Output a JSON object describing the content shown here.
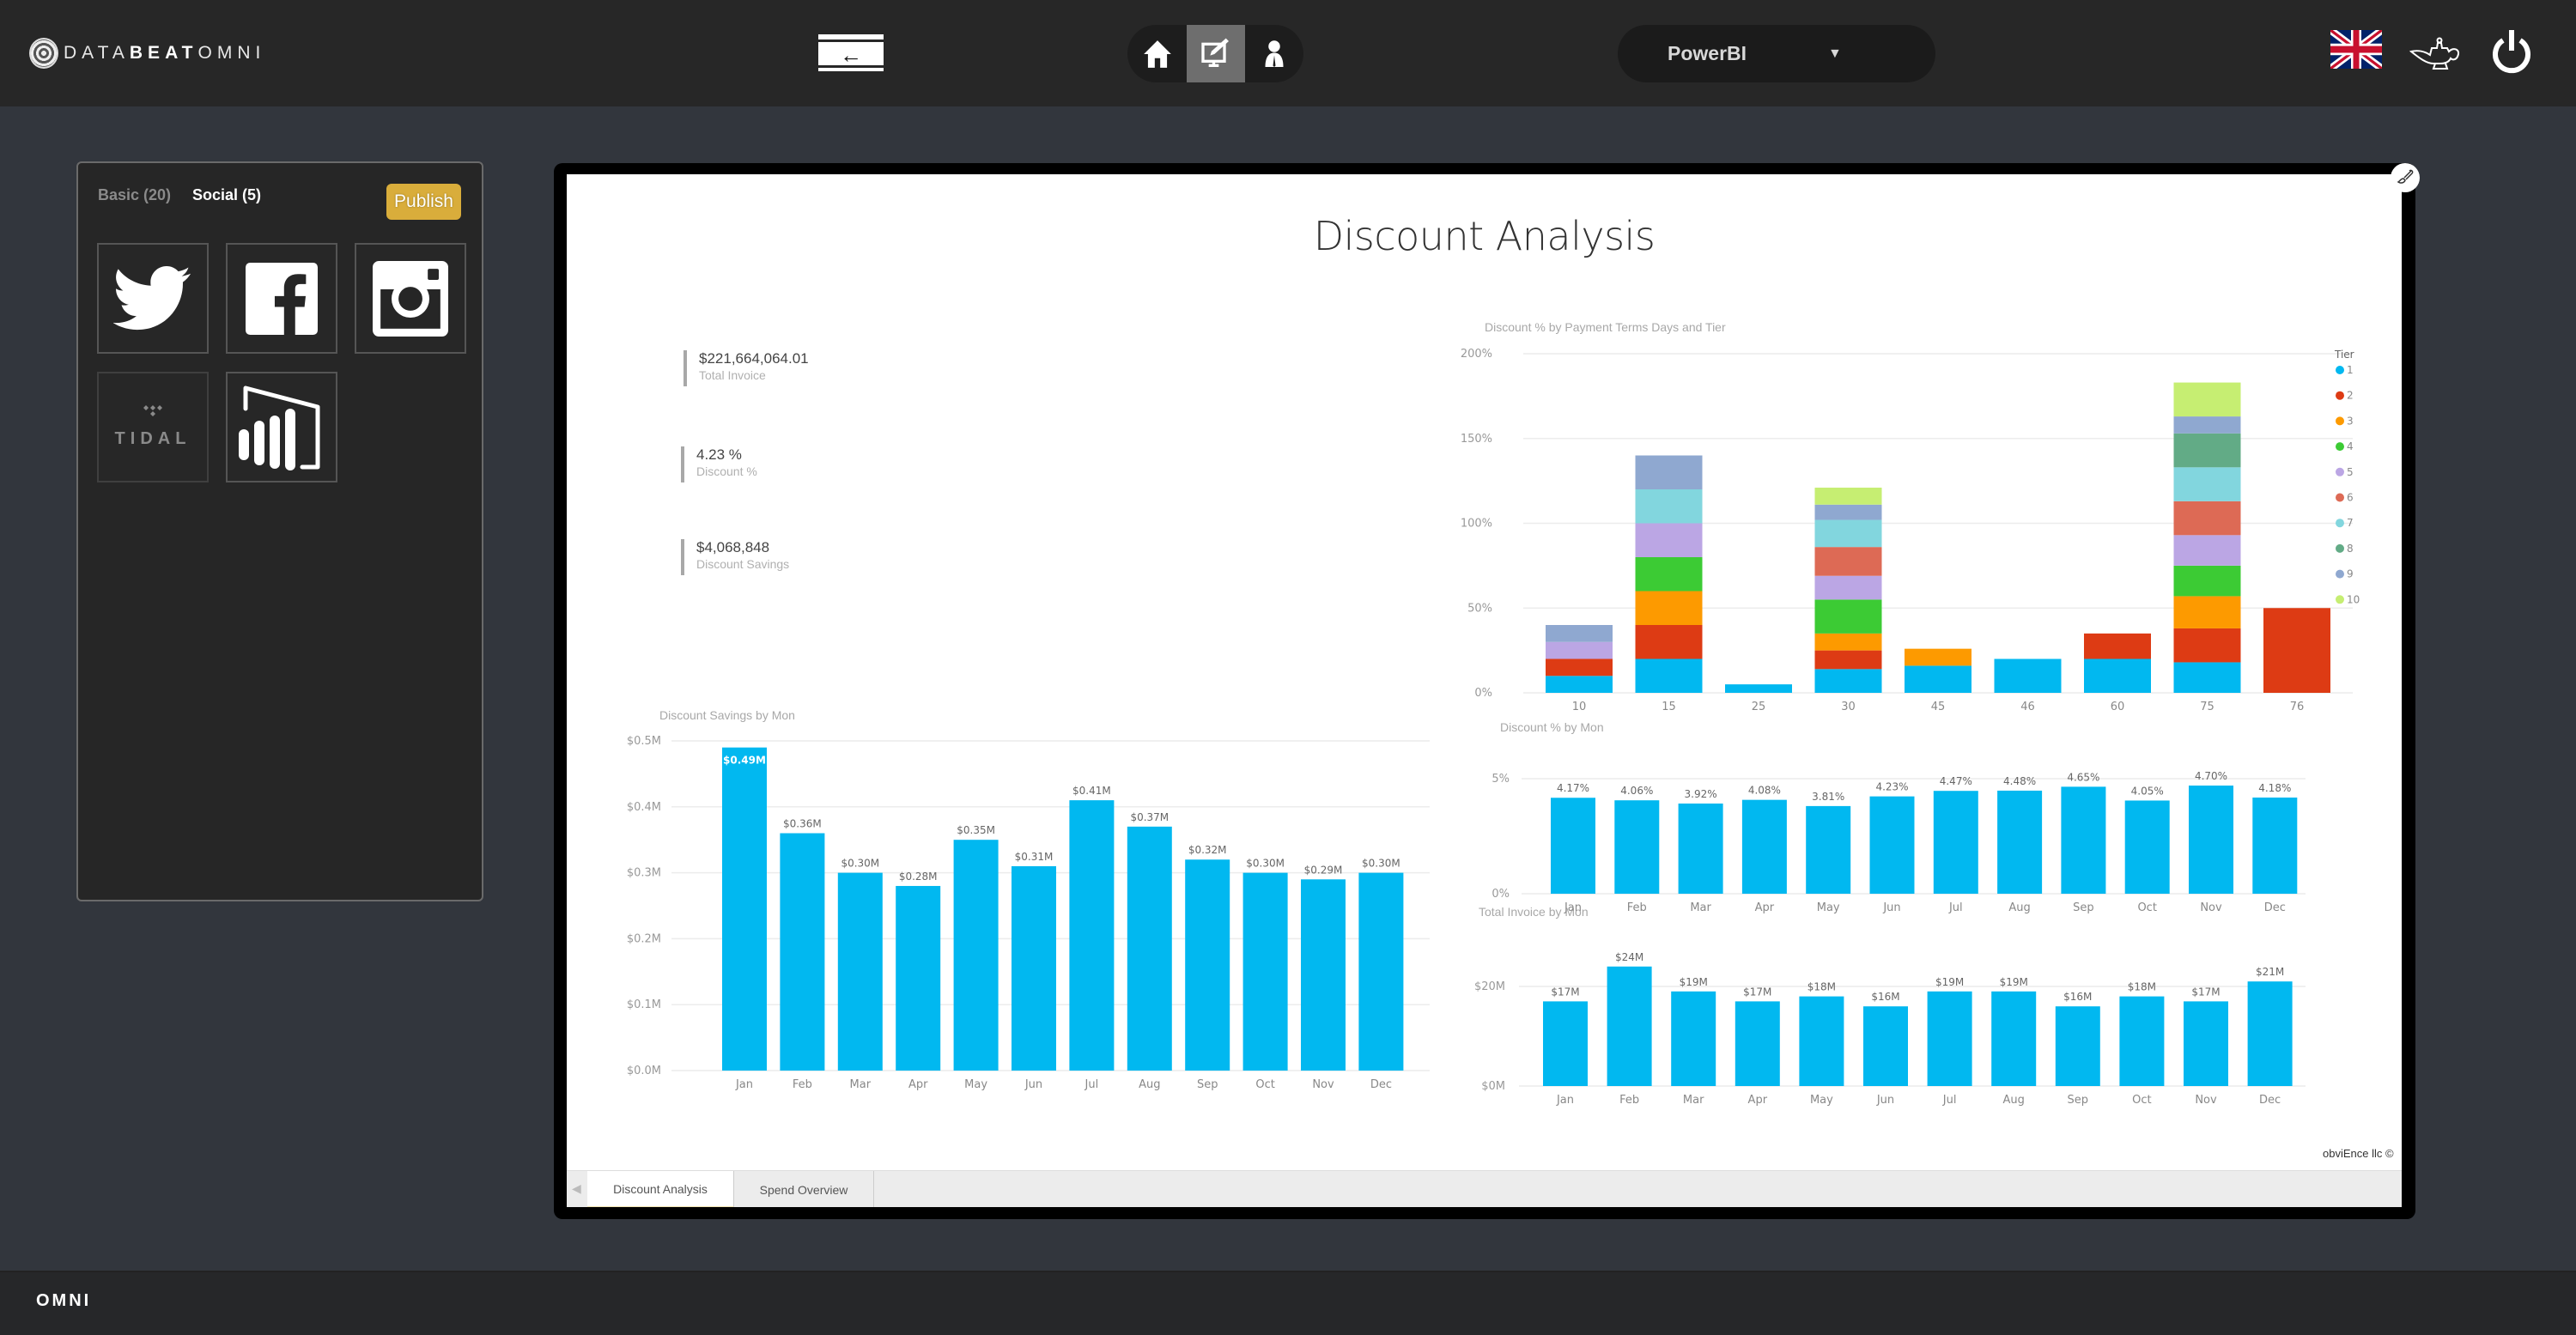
{
  "header": {
    "logo_prefix": "DATA",
    "logo_bold": "BEAT",
    "logo_suffix": "OMNI",
    "back_label": "←",
    "nav": [
      {
        "name": "home",
        "icon": "home-icon"
      },
      {
        "name": "editor",
        "icon": "monitor-pen-icon",
        "active": true
      },
      {
        "name": "user",
        "icon": "user-icon"
      }
    ],
    "platform_select": {
      "value": "PowerBI",
      "caret": "▼"
    },
    "language": "English (UK)",
    "icons": [
      "uk-flag-icon",
      "genie-lamp-icon",
      "power-icon"
    ]
  },
  "left_panel": {
    "tabs": [
      {
        "label": "Basic (20)",
        "active": false
      },
      {
        "label": "Social (5)",
        "active": true
      }
    ],
    "publish_label": "Publish",
    "tiles": [
      {
        "name": "twitter",
        "icon": "twitter-icon"
      },
      {
        "name": "facebook",
        "icon": "facebook-icon"
      },
      {
        "name": "instagram",
        "icon": "instagram-icon"
      },
      {
        "name": "tidal",
        "icon": "tidal-icon",
        "label": "TIDAL"
      },
      {
        "name": "powerbi",
        "icon": "powerbi-icon"
      }
    ]
  },
  "report": {
    "title": "Discount Analysis",
    "kpis": [
      {
        "value": "$221,664,064.01",
        "label": "Total Invoice"
      },
      {
        "value": "4.23 %",
        "label": "Discount %"
      },
      {
        "value": "$4,068,848",
        "label": "Discount Savings"
      }
    ],
    "page_tabs": [
      {
        "label": "Discount Analysis",
        "active": true
      },
      {
        "label": "Spend Overview",
        "active": false
      }
    ],
    "copyright": "obviEnce llc ©"
  },
  "chart_data": [
    {
      "id": "tier",
      "type": "bar",
      "stacked": true,
      "title": "Discount % by Payment Terms Days and Tier",
      "xlabel": "",
      "ylabel": "",
      "ylim": [
        0,
        200
      ],
      "yticks": [
        "0%",
        "50%",
        "100%",
        "150%",
        "200%"
      ],
      "yvalues": [
        0,
        50,
        100,
        150,
        200
      ],
      "grid": true,
      "legend_title": "Tier",
      "legend_position": "right",
      "categories": [
        "10",
        "15",
        "25",
        "30",
        "45",
        "46",
        "60",
        "75",
        "76"
      ],
      "series": [
        {
          "name": "1",
          "color": "#01b8f0",
          "values": [
            10,
            20,
            5,
            14,
            16,
            20,
            20,
            18,
            0
          ]
        },
        {
          "name": "2",
          "color": "#dd3b14",
          "values": [
            10,
            20,
            0,
            11,
            0,
            0,
            15,
            20,
            50
          ]
        },
        {
          "name": "3",
          "color": "#fd9a00",
          "values": [
            0,
            20,
            0,
            10,
            10,
            0,
            0,
            19,
            0
          ]
        },
        {
          "name": "4",
          "color": "#3ccb34",
          "values": [
            0,
            20,
            0,
            20,
            0,
            0,
            0,
            18,
            0
          ]
        },
        {
          "name": "5",
          "color": "#bba6e4",
          "values": [
            10,
            20,
            0,
            14,
            0,
            0,
            0,
            18,
            0
          ]
        },
        {
          "name": "6",
          "color": "#dd6a55",
          "values": [
            0,
            0,
            0,
            17,
            0,
            0,
            0,
            20,
            0
          ]
        },
        {
          "name": "7",
          "color": "#82d6de",
          "values": [
            0,
            20,
            0,
            16,
            0,
            0,
            0,
            20,
            0
          ]
        },
        {
          "name": "8",
          "color": "#62ab86",
          "values": [
            0,
            0,
            0,
            0,
            0,
            0,
            0,
            20,
            0
          ]
        },
        {
          "name": "9",
          "color": "#8fa8d0",
          "values": [
            10,
            20,
            0,
            9,
            0,
            0,
            0,
            10,
            0
          ]
        },
        {
          "name": "10",
          "color": "#c6ee72",
          "values": [
            0,
            0,
            0,
            10,
            0,
            0,
            0,
            20,
            0
          ]
        }
      ]
    },
    {
      "id": "savings",
      "type": "bar",
      "title": "Discount Savings by Mon",
      "xlabel": "",
      "ylabel": "",
      "ylim": [
        0,
        0.5
      ],
      "yticks": [
        "$0.0M",
        "$0.1M",
        "$0.2M",
        "$0.3M",
        "$0.4M",
        "$0.5M"
      ],
      "yvalues": [
        0,
        0.1,
        0.2,
        0.3,
        0.4,
        0.5
      ],
      "grid": true,
      "color": "#01b8f0",
      "categories": [
        "Jan",
        "Feb",
        "Mar",
        "Apr",
        "May",
        "Jun",
        "Jul",
        "Aug",
        "Sep",
        "Oct",
        "Nov",
        "Dec"
      ],
      "values": [
        0.49,
        0.36,
        0.3,
        0.28,
        0.35,
        0.31,
        0.41,
        0.37,
        0.32,
        0.3,
        0.29,
        0.3
      ],
      "labels": [
        "$0.49M",
        "$0.36M",
        "$0.30M",
        "$0.28M",
        "$0.35M",
        "$0.31M",
        "$0.41M",
        "$0.37M",
        "$0.32M",
        "$0.30M",
        "$0.29M",
        "$0.30M"
      ]
    },
    {
      "id": "discpct",
      "type": "bar",
      "title": "Discount % by Mon",
      "xlabel": "",
      "ylabel": "",
      "ylim": [
        0,
        5
      ],
      "yticks": [
        "0%",
        "5%"
      ],
      "yvalues": [
        0,
        5
      ],
      "grid": true,
      "color": "#01b8f0",
      "categories": [
        "Jan",
        "Feb",
        "Mar",
        "Apr",
        "May",
        "Jun",
        "Jul",
        "Aug",
        "Sep",
        "Oct",
        "Nov",
        "Dec"
      ],
      "values": [
        4.17,
        4.06,
        3.92,
        4.08,
        3.81,
        4.23,
        4.47,
        4.48,
        4.65,
        4.05,
        4.7,
        4.18
      ],
      "labels": [
        "4.17%",
        "4.06%",
        "3.92%",
        "4.08%",
        "3.81%",
        "4.23%",
        "4.47%",
        "4.48%",
        "4.65%",
        "4.05%",
        "4.70%",
        "4.18%"
      ]
    },
    {
      "id": "invoice",
      "type": "bar",
      "title": "Total Invoice by Mon",
      "xlabel": "",
      "ylabel": "",
      "ylim": [
        0,
        20
      ],
      "yticks": [
        "$0M",
        "$20M"
      ],
      "yvalues": [
        0,
        20
      ],
      "grid": true,
      "color": "#01b8f0",
      "categories": [
        "Jan",
        "Feb",
        "Mar",
        "Apr",
        "May",
        "Jun",
        "Jul",
        "Aug",
        "Sep",
        "Oct",
        "Nov",
        "Dec"
      ],
      "values": [
        17,
        24,
        19,
        17,
        18,
        16,
        19,
        19,
        16,
        18,
        17,
        21
      ],
      "labels": [
        "$17M",
        "$24M",
        "$19M",
        "$17M",
        "$18M",
        "$16M",
        "$19M",
        "$19M",
        "$16M",
        "$18M",
        "$17M",
        "$21M"
      ]
    }
  ],
  "footer": {
    "brand": "OMNI"
  }
}
